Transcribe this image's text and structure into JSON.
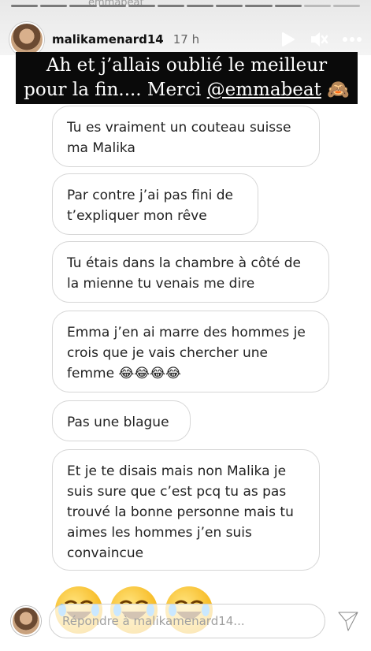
{
  "story": {
    "progress_segments": 12,
    "progress_done": 10,
    "ghost_text": "emmabeat",
    "username": "malikamenard14",
    "time": "17 h",
    "caption_line1": "Ah et j’allais oublié le meilleur",
    "caption_line2_prefix": "pour la fin.... Merci ",
    "caption_mention": "@emmabeat",
    "caption_emoji": "🙈",
    "messages": [
      "Tu es vraiment un couteau suisse\nma Malika",
      "Par contre j’ai pas fini de\nt’expliquer mon rêve",
      "Tu étais dans la chambre à côté de\nla mienne tu venais me dire",
      "Emma j’en ai marre des hommes je\ncrois que je vais chercher une\nfemme 😂😂😂😂",
      "Pas une blague",
      "Et je te disais mais non Malika je\nsuis sure que c’est pcq tu as pas\ntrouvé la bonne personne mais tu\naimes les hommes j’en suis\nconvaincue"
    ],
    "reply_placeholder": "Répondre à malikamenard14...",
    "icons": [
      "play-icon",
      "mute-icon",
      "more-icon",
      "send-icon"
    ]
  }
}
